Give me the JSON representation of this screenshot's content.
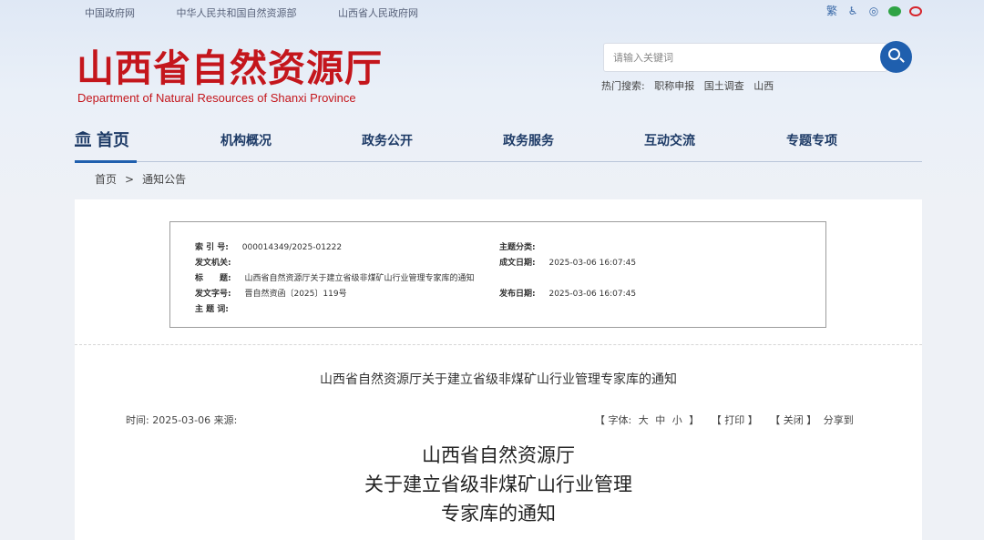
{
  "top_links": [
    "中国政府网",
    "中华人民共和国自然资源部",
    "山西省人民政府网"
  ],
  "top_icons": {
    "traditional": "繁",
    "accessibility": "accessibility-icon",
    "elder": "elder-mode-icon",
    "wechat": "wechat-icon",
    "weibo": "weibo-icon"
  },
  "logo": {
    "cn": "山西省自然资源厅",
    "en": "Department of Natural Resources of Shanxi Province"
  },
  "search": {
    "placeholder": "请输入关键词",
    "hot_label": "热门搜索:",
    "hot_terms": [
      "职称申报",
      "国土调查",
      "山西"
    ]
  },
  "nav": {
    "home": "首页",
    "items": [
      "机构概况",
      "政务公开",
      "政务服务",
      "互动交流",
      "专题专项"
    ]
  },
  "breadcrumb": {
    "home": "首页",
    "sep": ">",
    "current": "通知公告"
  },
  "meta": {
    "index_label": "索 引 号:",
    "index_value": "000014349/2025-01222",
    "subject_label": "主题分类:",
    "subject_value": "",
    "issuer_label": "发文机关:",
    "issuer_value": "",
    "written_label": "成文日期:",
    "written_value": "2025-03-06 16:07:45",
    "title_label": "标　　题:",
    "title_value": "山西省自然资源厅关于建立省级非煤矿山行业管理专家库的通知",
    "docno_label": "发文字号:",
    "docno_value": "晋自然资函〔2025〕119号",
    "published_label": "发布日期:",
    "published_value": "2025-03-06 16:07:45",
    "keywords_label": "主 题 词:",
    "keywords_value": ""
  },
  "doc_title": "山西省自然资源厅关于建立省级非煤矿山行业管理专家库的通知",
  "info": {
    "time_label": "时间:",
    "time_value": "2025-03-06",
    "source_label": "来源:",
    "font_open": "【 字体:",
    "font_large": "大",
    "font_medium": "中",
    "font_small": "小",
    "font_close": "】",
    "print": "【 打印 】",
    "close": "【 关闭 】",
    "share": "分享到"
  },
  "body_title": [
    "山西省自然资源厅",
    "关于建立省级非煤矿山行业管理",
    "专家库的通知"
  ]
}
